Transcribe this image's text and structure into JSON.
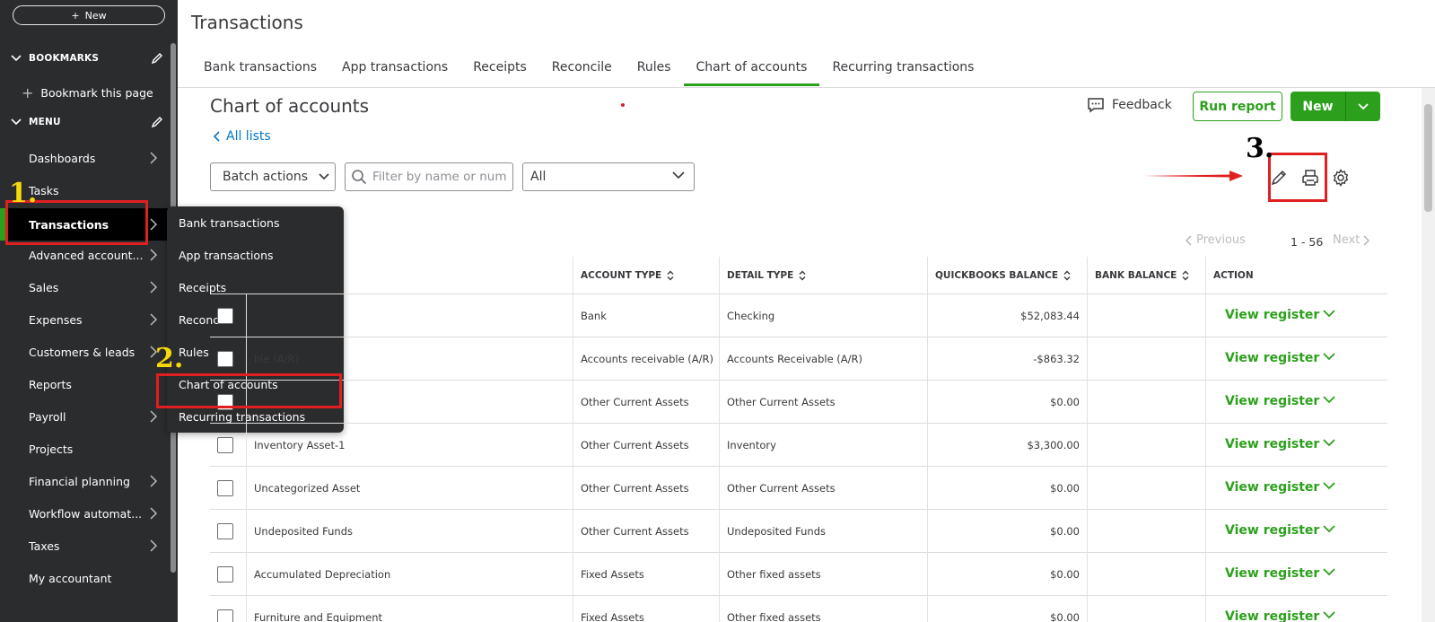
{
  "sidebar": {
    "new_label": "New",
    "bookmarks_label": "BOOKMARKS",
    "bookmark_this_page": "Bookmark this page",
    "menu_label": "MENU",
    "items": [
      {
        "label": "Dashboards"
      },
      {
        "label": "Tasks"
      },
      {
        "label": "Transactions"
      },
      {
        "label": "Advanced account..."
      },
      {
        "label": "Sales"
      },
      {
        "label": "Expenses"
      },
      {
        "label": "Customers & leads"
      },
      {
        "label": "Reports"
      },
      {
        "label": "Payroll"
      },
      {
        "label": "Projects"
      },
      {
        "label": "Financial planning"
      },
      {
        "label": "Workflow automat..."
      },
      {
        "label": "Taxes"
      },
      {
        "label": "My accountant"
      }
    ],
    "flyout": [
      {
        "label": "Bank transactions"
      },
      {
        "label": "App transactions"
      },
      {
        "label": "Receipts"
      },
      {
        "label": "Reconcile"
      },
      {
        "label": "Rules"
      },
      {
        "label": "Chart of accounts"
      },
      {
        "label": "Recurring transactions"
      }
    ]
  },
  "header": {
    "title": "Transactions",
    "tabs": [
      {
        "label": "Bank transactions"
      },
      {
        "label": "App transactions"
      },
      {
        "label": "Receipts"
      },
      {
        "label": "Reconcile"
      },
      {
        "label": "Rules"
      },
      {
        "label": "Chart of accounts"
      },
      {
        "label": "Recurring transactions"
      }
    ]
  },
  "page": {
    "title": "Chart of accounts",
    "all_lists": "All lists",
    "feedback": "Feedback",
    "run_report": "Run report",
    "new": "New",
    "batch_actions": "Batch actions",
    "filter_placeholder": "Filter by name or number",
    "type_select": "All",
    "pager_prev": "Previous",
    "pager_count": "1 - 56",
    "pager_next": "Next"
  },
  "table": {
    "headers": {
      "account_type": "ACCOUNT TYPE",
      "detail_type": "DETAIL TYPE",
      "qb_balance": "QUICKBOOKS BALANCE",
      "bank_balance": "BANK BALANCE",
      "action": "ACTION"
    },
    "action_label": "View register",
    "rows": [
      {
        "name": "",
        "type": "Bank",
        "detail": "Checking",
        "balance": "$52,083.44"
      },
      {
        "name": "ble (A/R)",
        "type": "Accounts receivable (A/R)",
        "detail": "Accounts Receivable (A/R)",
        "balance": "-$863.32"
      },
      {
        "name": "",
        "type": "Other Current Assets",
        "detail": "Other Current Assets",
        "balance": "$0.00"
      },
      {
        "name": "Inventory Asset-1",
        "type": "Other Current Assets",
        "detail": "Inventory",
        "balance": "$3,300.00"
      },
      {
        "name": "Uncategorized Asset",
        "type": "Other Current Assets",
        "detail": "Other Current Assets",
        "balance": "$0.00"
      },
      {
        "name": "Undeposited Funds",
        "type": "Other Current Assets",
        "detail": "Undeposited Funds",
        "balance": "$0.00"
      },
      {
        "name": "Accumulated Depreciation",
        "type": "Fixed Assets",
        "detail": "Other fixed assets",
        "balance": "$0.00"
      },
      {
        "name": "Furniture and Equipment",
        "type": "Fixed Assets",
        "detail": "Other fixed assets",
        "balance": "$0.00"
      }
    ]
  },
  "annotations": {
    "step1": "1.",
    "step2": "2.",
    "step3": "3.",
    "color_box": "#e02020",
    "color_num_yellow": "#f5d90a"
  },
  "colors": {
    "brand_green": "#2ca01c",
    "sidebar_bg": "#2b2c2e",
    "link_blue": "#0077c5"
  }
}
